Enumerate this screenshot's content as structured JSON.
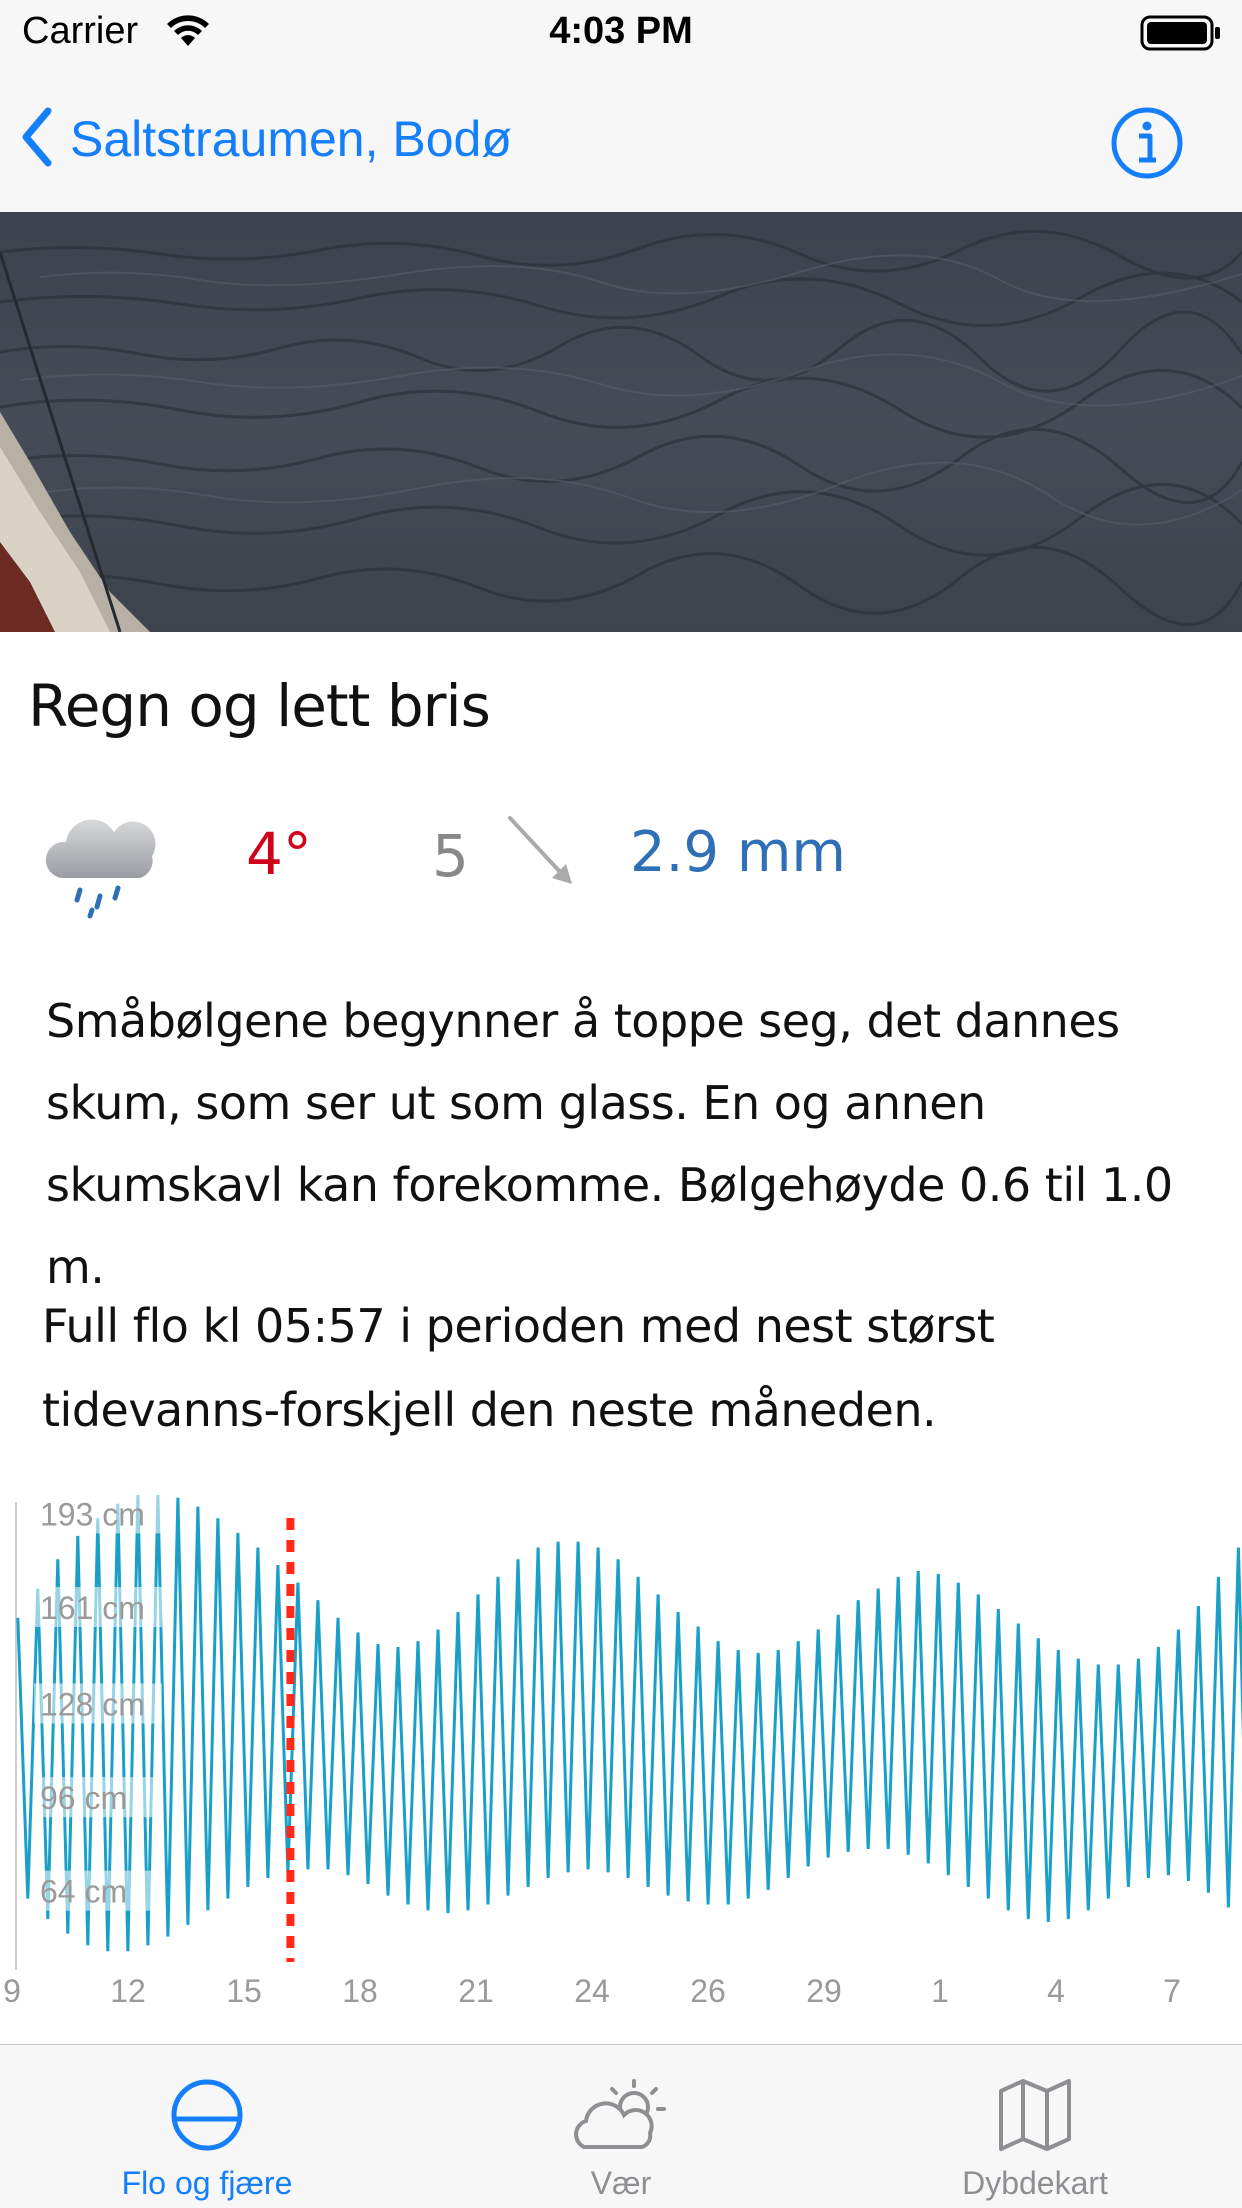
{
  "status_bar": {
    "carrier": "Carrier",
    "time": "4:03 PM"
  },
  "nav": {
    "back_label": "Saltstraumen, Bodø",
    "info_icon": "info-circle-icon"
  },
  "weather": {
    "title": "Regn og lett bris",
    "icon": "rain-cloud-icon",
    "temperature": "4°",
    "wind_speed": "5",
    "wind_direction_icon": "wind-arrow-icon",
    "precipitation": "2.9 mm",
    "colors": {
      "temperature": "#d0021b",
      "wind": "#888888",
      "precipitation": "#2f6fb6"
    }
  },
  "sea_description": "Småbølgene begynner å toppe seg, det dannes skum, som ser ut som glass. En og annen skumskavl kan forekomme. Bølgehøyde 0.6 til 1.0 m.",
  "tide_text": "Full flo kl 05:57 i perioden med nest størst tidevanns-forskjell den neste måneden.",
  "chart_data": {
    "type": "line",
    "title": "",
    "xlabel": "",
    "ylabel": "",
    "y_tick_labels": [
      "193 cm",
      "161 cm",
      "128 cm",
      "96 cm",
      "64 cm"
    ],
    "y_ticks": [
      193,
      161,
      128,
      96,
      64
    ],
    "x_tick_labels": [
      "9",
      "12",
      "15",
      "18",
      "21",
      "24",
      "26",
      "29",
      "1",
      "4",
      "7"
    ],
    "x_ticks_day": [
      9,
      12,
      15,
      18,
      21,
      24,
      27,
      30,
      33,
      36,
      39
    ],
    "xlim_day": [
      9,
      40.5
    ],
    "ylim": [
      41,
      201
    ],
    "current_time_day": 16.2,
    "series": [
      {
        "color": "#1aa0c8",
        "cycle_days": 0.5175,
        "start_day": 9.15,
        "high_values": [
          158,
          168,
          178,
          186,
          192,
          197,
          200,
          200,
          199,
          196,
          192,
          187,
          182,
          176,
          170,
          164,
          158,
          153,
          149,
          148,
          150,
          154,
          160,
          166,
          172,
          178,
          182,
          184,
          184,
          182,
          178,
          172,
          166,
          160,
          155,
          150,
          147,
          146,
          147,
          150,
          154,
          159,
          164,
          168,
          172,
          174,
          173,
          170,
          166,
          161,
          156,
          151,
          147,
          144,
          142,
          142,
          144,
          148,
          154,
          162,
          172,
          182,
          190
        ],
        "low_values": [
          62,
          55,
          50,
          46,
          44,
          44,
          46,
          49,
          53,
          58,
          62,
          66,
          69,
          71,
          72,
          72,
          70,
          67,
          63,
          60,
          58,
          57,
          58,
          60,
          63,
          66,
          69,
          71,
          72,
          71,
          69,
          66,
          63,
          61,
          60,
          60,
          62,
          65,
          69,
          73,
          76,
          78,
          79,
          79,
          77,
          74,
          70,
          66,
          62,
          58,
          55,
          54,
          55,
          58,
          62,
          66,
          69,
          70,
          68,
          64,
          59,
          54,
          50
        ]
      }
    ],
    "grid": false,
    "legend": "none",
    "marker_color": "#ff2a1a"
  },
  "tabs": [
    {
      "label": "Flo og fjære",
      "icon": "tide-circle-icon",
      "active": true
    },
    {
      "label": "Vær",
      "icon": "partly-cloudy-icon",
      "active": false
    },
    {
      "label": "Dybdekart",
      "icon": "map-icon",
      "active": false
    }
  ],
  "colors": {
    "accent": "#147efb",
    "inactive": "#8e8e93",
    "chart_line": "#1aa0c8",
    "now_marker": "#ff2a1a"
  }
}
